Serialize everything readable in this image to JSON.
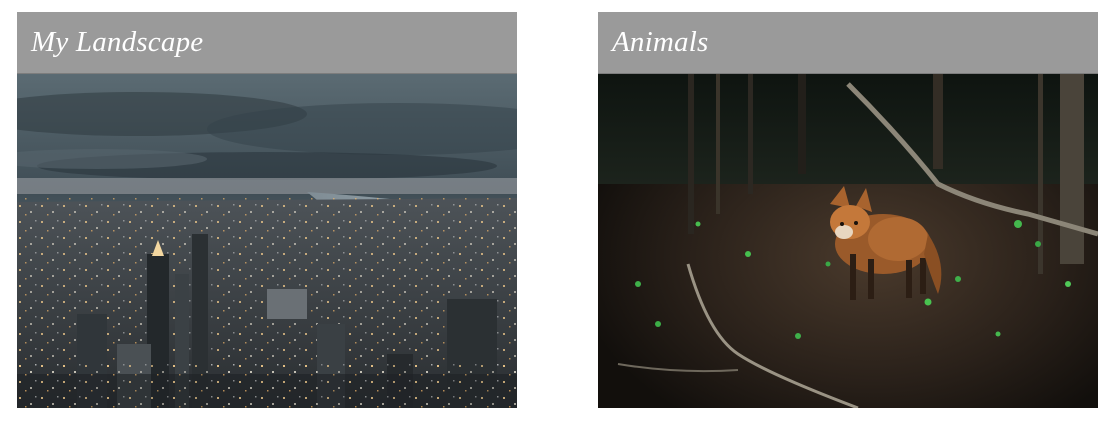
{
  "cards": [
    {
      "title": "My Landscape",
      "image_subject": "aerial city skyline at dusk"
    },
    {
      "title": "Animals",
      "image_subject": "fox in a dark forest"
    }
  ],
  "colors": {
    "header_bg": "#9a9a9a",
    "title_text": "#ffffff",
    "page_bg": "#ffffff"
  }
}
